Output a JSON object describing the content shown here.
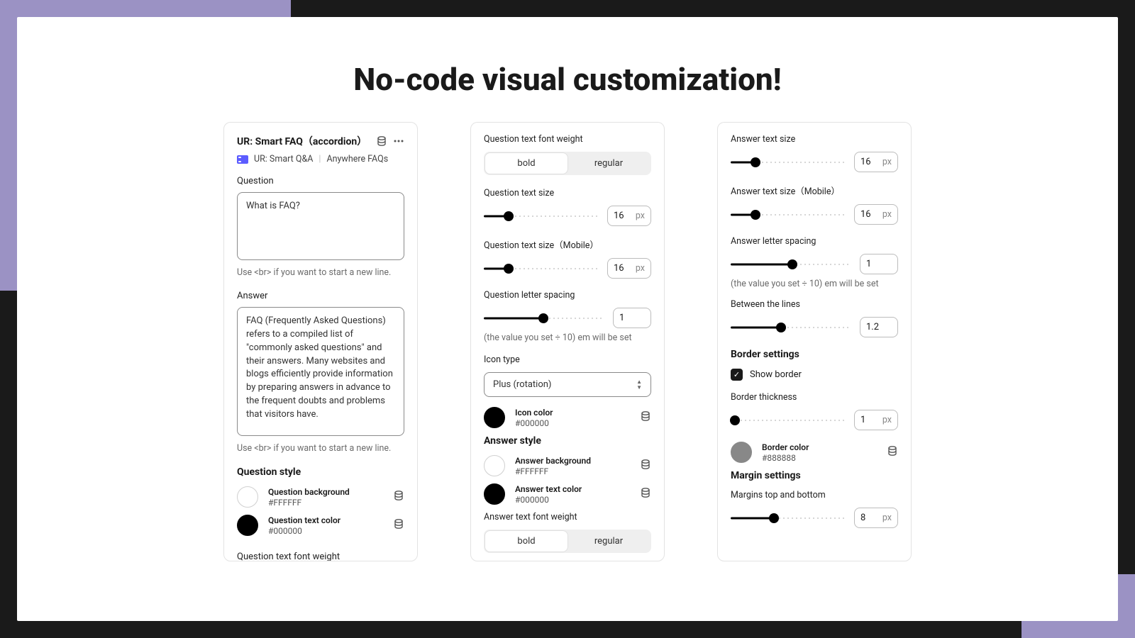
{
  "headline": "No-code visual customization!",
  "panel1": {
    "title": "UR: Smart FAQ（accordion）",
    "crumb_app": "UR: Smart Q&A",
    "crumb_section": "Anywhere FAQs",
    "q_label": "Question",
    "q_value": "What is FAQ?",
    "q_helper": "Use <br> if you want to start a new line.",
    "a_label": "Answer",
    "a_value": "FAQ (Frequently Asked Questions) refers to a compiled list of \"commonly asked questions\" and their answers. Many websites and blogs efficiently provide information by preparing answers in advance to the frequent doubts and problems that visitors have.",
    "a_helper": "Use <br> if you want to start a new line.",
    "qstyle_heading": "Question style",
    "qbg_name": "Question background",
    "qbg_hex": "#FFFFFF",
    "qtc_name": "Question text color",
    "qtc_hex": "#000000",
    "truncated": "Question text font weight"
  },
  "panel2": {
    "qfw_label": "Question text font weight",
    "fw_bold": "bold",
    "fw_regular": "regular",
    "qts_label": "Question text size",
    "qts_value": "16",
    "qts_unit": "px",
    "qtsm_label": "Question text size（Mobile）",
    "qtsm_value": "16",
    "qtsm_unit": "px",
    "qls_label": "Question letter spacing",
    "qls_value": "1",
    "qls_helper": "(the value you set ÷ 10) em will be set",
    "icon_type_label": "Icon type",
    "icon_type_value": "Plus (rotation)",
    "icon_color_name": "Icon color",
    "icon_color_hex": "#000000",
    "astyle_heading": "Answer style",
    "abg_name": "Answer background",
    "abg_hex": "#FFFFFF",
    "atc_name": "Answer text color",
    "atc_hex": "#000000",
    "afw_label": "Answer text font weight"
  },
  "panel3": {
    "ats_label": "Answer text size",
    "ats_value": "16",
    "ats_unit": "px",
    "atsm_label": "Answer text size（Mobile）",
    "atsm_value": "16",
    "atsm_unit": "px",
    "als_label": "Answer letter spacing",
    "als_value": "1",
    "als_helper": "(the value you set ÷ 10) em will be set",
    "btl_label": "Between the lines",
    "btl_value": "1.2",
    "border_heading": "Border settings",
    "show_border_label": "Show border",
    "bt_label": "Border thickness",
    "bt_value": "1",
    "bt_unit": "px",
    "bc_name": "Border color",
    "bc_hex": "#888888",
    "margin_heading": "Margin settings",
    "mtb_label": "Margins top and bottom",
    "mtb_value": "8",
    "mtb_unit": "px"
  }
}
